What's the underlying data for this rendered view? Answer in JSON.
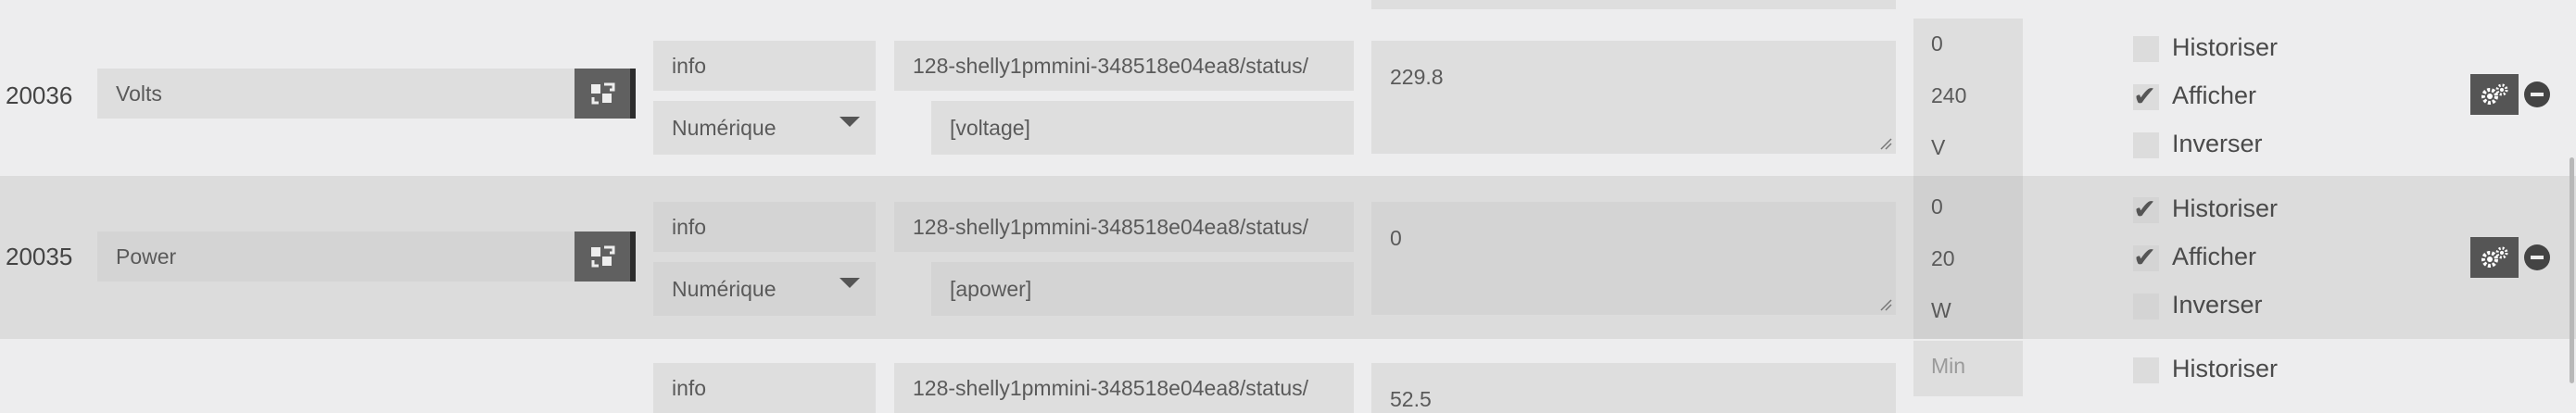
{
  "rows": [
    {
      "id": "20036",
      "name": "Volts",
      "type": "info",
      "subtype": "Numérique",
      "topic": "128-shelly1pmmini-348518e04ea8/status/",
      "json_path": "[voltage]",
      "value": "229.8",
      "min": "0",
      "max": "240",
      "unit": "V",
      "historiser": false,
      "afficher": true,
      "inverser": false
    },
    {
      "id": "20035",
      "name": "Power",
      "type": "info",
      "subtype": "Numérique",
      "topic": "128-shelly1pmmini-348518e04ea8/status/",
      "json_path": "[apower]",
      "value": "0",
      "min": "0",
      "max": "20",
      "unit": "W",
      "historiser": true,
      "afficher": true,
      "inverser": false
    },
    {
      "type": "info",
      "topic": "128-shelly1pmmini-348518e04ea8/status/",
      "value": "52.5",
      "min_placeholder": "Min"
    }
  ],
  "labels": {
    "historiser": "Historiser",
    "afficher": "Afficher",
    "inverser": "Inverser"
  },
  "icons": {
    "config": "config-share-icon",
    "gears": "gears-icon",
    "remove": "minus-circle-icon",
    "check": "check-icon",
    "caret": "caret-down-icon"
  }
}
